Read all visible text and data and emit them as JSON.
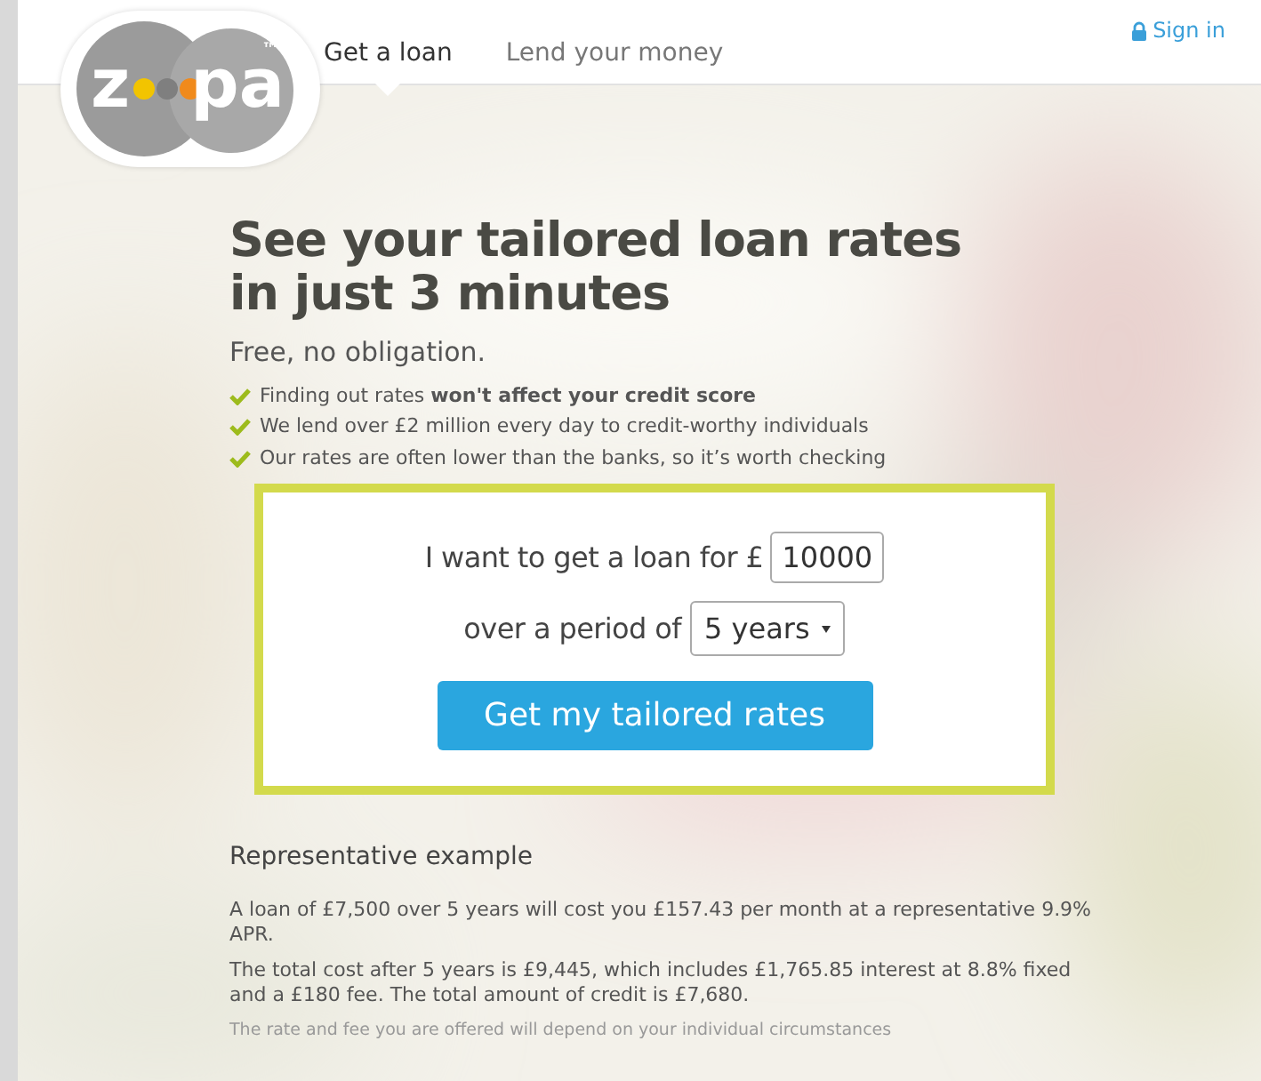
{
  "logo": {
    "left": "z",
    "right": "pa",
    "mark": "™"
  },
  "nav": [
    {
      "label": "Get a loan",
      "selected": true
    },
    {
      "label": "Lend your money",
      "selected": false
    }
  ],
  "sign_in": "Sign in",
  "heading": [
    "See your tailored loan rates",
    "in just 3 minutes"
  ],
  "subheading": "Free, no obligation.",
  "benefits": [
    "Finding out rates **won't affect your credit score**",
    "We lend over £2 million every day to credit-worthy individuals",
    "Our rates are often lower than the banks, so it’s worth checking"
  ],
  "form": {
    "amount_label": "I want to get a loan for £",
    "amount_value": "10000",
    "period_label": "over a period of",
    "period_value": "5 years",
    "submit": "Get my tailored rates"
  },
  "example": {
    "title": "Representative example",
    "paragraphs": [
      "A loan of £7,500 over 5 years will cost you £157.43 per month at a representative 9.9% APR.",
      "The total cost after 5 years is £9,445, which includes £1,765.85 interest at 8.8% fixed and a £180 fee. The total amount of credit is £7,680."
    ],
    "note": "The rate and fee you are offered will depend on your individual circumstances"
  }
}
